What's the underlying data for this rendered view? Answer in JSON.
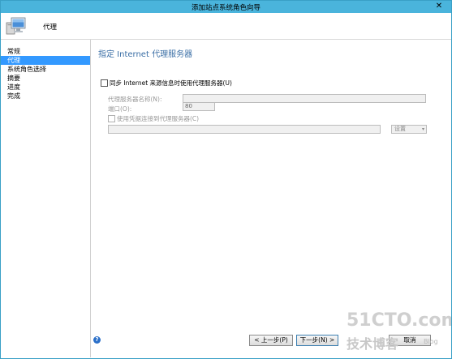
{
  "window": {
    "title": "添加站点系统角色向导",
    "close_glyph": "✕"
  },
  "header": {
    "title": "代理",
    "icon": "computer-monitor-icon"
  },
  "nav": {
    "items": [
      {
        "label": "常规",
        "selected": false
      },
      {
        "label": "代理",
        "selected": true
      },
      {
        "label": "系统角色选择",
        "selected": false
      },
      {
        "label": "摘要",
        "selected": false
      },
      {
        "label": "进度",
        "selected": false
      },
      {
        "label": "完成",
        "selected": false
      }
    ]
  },
  "page": {
    "title": "指定 Internet 代理服务器",
    "sync_checkbox_label": "同步 Internet 来源信息时使用代理服务器(U)",
    "proxy_name_label": "代理服务器名称(N):",
    "proxy_name_value": "",
    "port_label": "端口(O):",
    "port_value": "80",
    "credentials_checkbox_label": "使用凭据连接到代理服务器(C)",
    "credentials_value": "",
    "settings_select_value": "设置",
    "settings_arrow": "▾"
  },
  "footer": {
    "help_glyph": "?",
    "prev_label": "< 上一步(P)",
    "next_label": "下一步(N) >",
    "cancel_label": "取消"
  },
  "watermark": {
    "line1": "51CTO.com",
    "line2": "技术博客",
    "line3": "Blog"
  },
  "colors": {
    "titlebar": "#4ab4dc",
    "accent": "#3399ff",
    "page_title": "#3a6ea5"
  }
}
